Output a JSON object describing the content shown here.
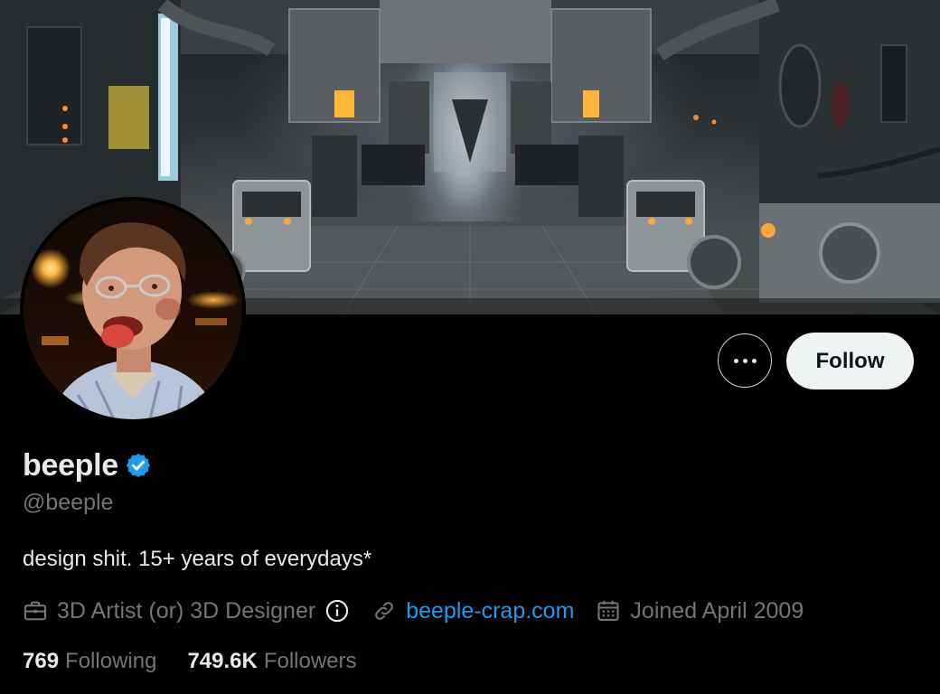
{
  "profile": {
    "display_name": "beeple",
    "handle": "@beeple",
    "bio": "design shit. 15+ years of everydays*",
    "verified_icon": "verified-badge-icon",
    "verified_color": "#1d9bf0"
  },
  "actions": {
    "more_icon": "more-horizontal-icon",
    "follow_label": "Follow"
  },
  "meta": {
    "profession": "3D Artist (or) 3D Designer",
    "profession_icon": "briefcase-icon",
    "info_icon": "info-icon",
    "website": "beeple-crap.com",
    "website_icon": "link-icon",
    "joined": "Joined April 2009",
    "joined_icon": "calendar-icon"
  },
  "stats": {
    "following_count": "769",
    "following_label": "Following",
    "followers_count": "749.6K",
    "followers_label": "Followers"
  },
  "colors": {
    "background": "#000000",
    "text_primary": "#e7e9ea",
    "text_secondary": "#71767b",
    "link": "#1d9bf0",
    "follow_button_bg": "#eff3f4"
  }
}
